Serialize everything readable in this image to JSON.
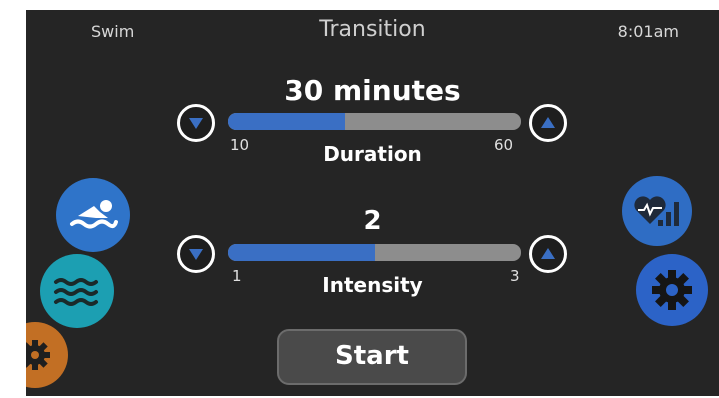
{
  "header": {
    "mode": "Swim",
    "title": "Transition",
    "time": "8:01am"
  },
  "duration": {
    "value_text": "30 minutes",
    "label": "Duration",
    "min": "10",
    "max": "60",
    "value": 30,
    "min_value": 10,
    "max_value": 60
  },
  "intensity": {
    "value_text": "2",
    "label": "Intensity",
    "min": "1",
    "max": "3",
    "value": 2,
    "min_value": 1,
    "max_value": 3
  },
  "start_label": "Start",
  "icons": {
    "swim": "swimmer-icon",
    "water": "water-waves-icon",
    "settings": "gear-icon",
    "heart_stats": "heart-rate-stats-icon"
  },
  "colors": {
    "slider_fill": "#3a6fc4",
    "slider_track": "#8d8d8d",
    "swim": "#2f74c9",
    "water": "#1c9fb2",
    "settings_left": "#c26f24",
    "settings_right": "#2c63c7"
  }
}
